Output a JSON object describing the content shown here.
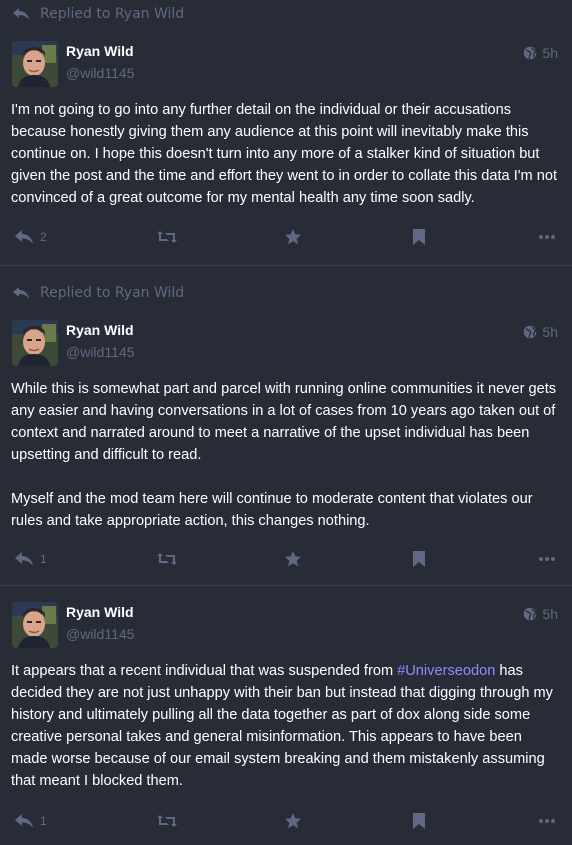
{
  "colors": {
    "background": "#282c37",
    "divider": "#393f4f",
    "muted": "#606984",
    "text": "#ffffff",
    "hashtag": "#8c8dff"
  },
  "icons": {
    "reply": "reply-arrow-icon",
    "boost": "boost-retweet-icon",
    "favourite": "star-icon",
    "bookmark": "bookmark-icon",
    "more": "ellipsis-icon",
    "visibility": "globe-icon"
  },
  "statuses": [
    {
      "prepend": "Replied to Ryan Wild",
      "display_name": "Ryan Wild",
      "handle": "@wild1145",
      "time": "5h",
      "paragraphs": [
        "I'm not going to go into any further detail on the individual or their accusations because honestly giving them any audience at this point will inevitably make this continue on. I hope this doesn't turn into any more of a stalker kind of situation but given the post and the time and effort they went to in order to collate this data I'm not convinced of a great outcome for my mental health any time soon sadly."
      ],
      "reply_count": "2"
    },
    {
      "prepend": "Replied to Ryan Wild",
      "display_name": "Ryan Wild",
      "handle": "@wild1145",
      "time": "5h",
      "paragraphs": [
        "While this is somewhat part and parcel with running online communities it never gets any easier and having conversations in a lot of cases from 10 years ago taken out of context and narrated around to meet a narrative of the upset individual has been upsetting and difficult to read.",
        "Myself and the mod team here will continue to moderate content that violates our rules and take appropriate action, this changes nothing."
      ],
      "reply_count": "1"
    },
    {
      "display_name": "Ryan Wild",
      "handle": "@wild1145",
      "time": "5h",
      "content_before_tag": "It appears that a recent individual that was suspended from ",
      "hashtag": "#Universeodon",
      "content_after_tag": " has decided they are not just unhappy with their ban but instead that digging through my history and ultimately pulling all the data together as part of dox along side some creative personal takes and general misinformation. This appears to have been made worse because of our email system breaking and them mistakenly assuming that meant I blocked them.",
      "reply_count": "1"
    }
  ]
}
